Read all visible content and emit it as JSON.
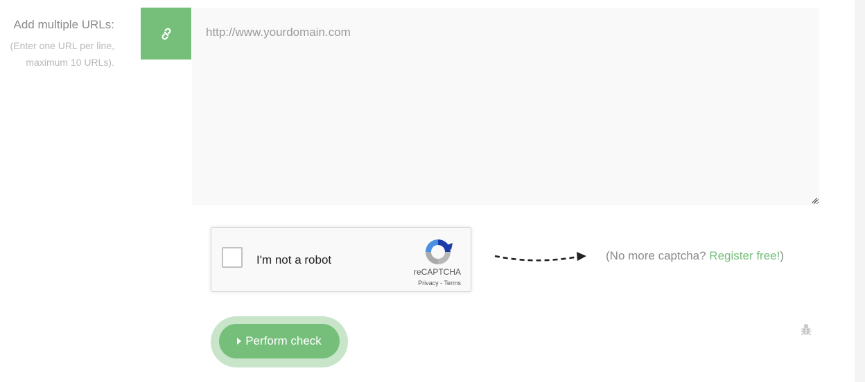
{
  "form": {
    "label": "Add multiple URLs:",
    "hint_line1": "(Enter one URL per line,",
    "hint_line2": "maximum 10 URLs).",
    "link_icon": "link-icon",
    "url_placeholder": "http://www.yourdomain.com",
    "url_value": ""
  },
  "recaptcha": {
    "checkbox_label": "I'm not a robot",
    "brand": "reCAPTCHA",
    "privacy": "Privacy",
    "separator": " - ",
    "terms": "Terms",
    "checked": false
  },
  "register": {
    "prefix": "(No more captcha? ",
    "link": "Register free!",
    "suffix": ")"
  },
  "actions": {
    "perform_label": "Perform check",
    "bug_icon": "bug-icon"
  },
  "colors": {
    "accent": "#76bf7b",
    "accent_light": "#c8e5c9",
    "label_text": "#8a8a8a"
  }
}
